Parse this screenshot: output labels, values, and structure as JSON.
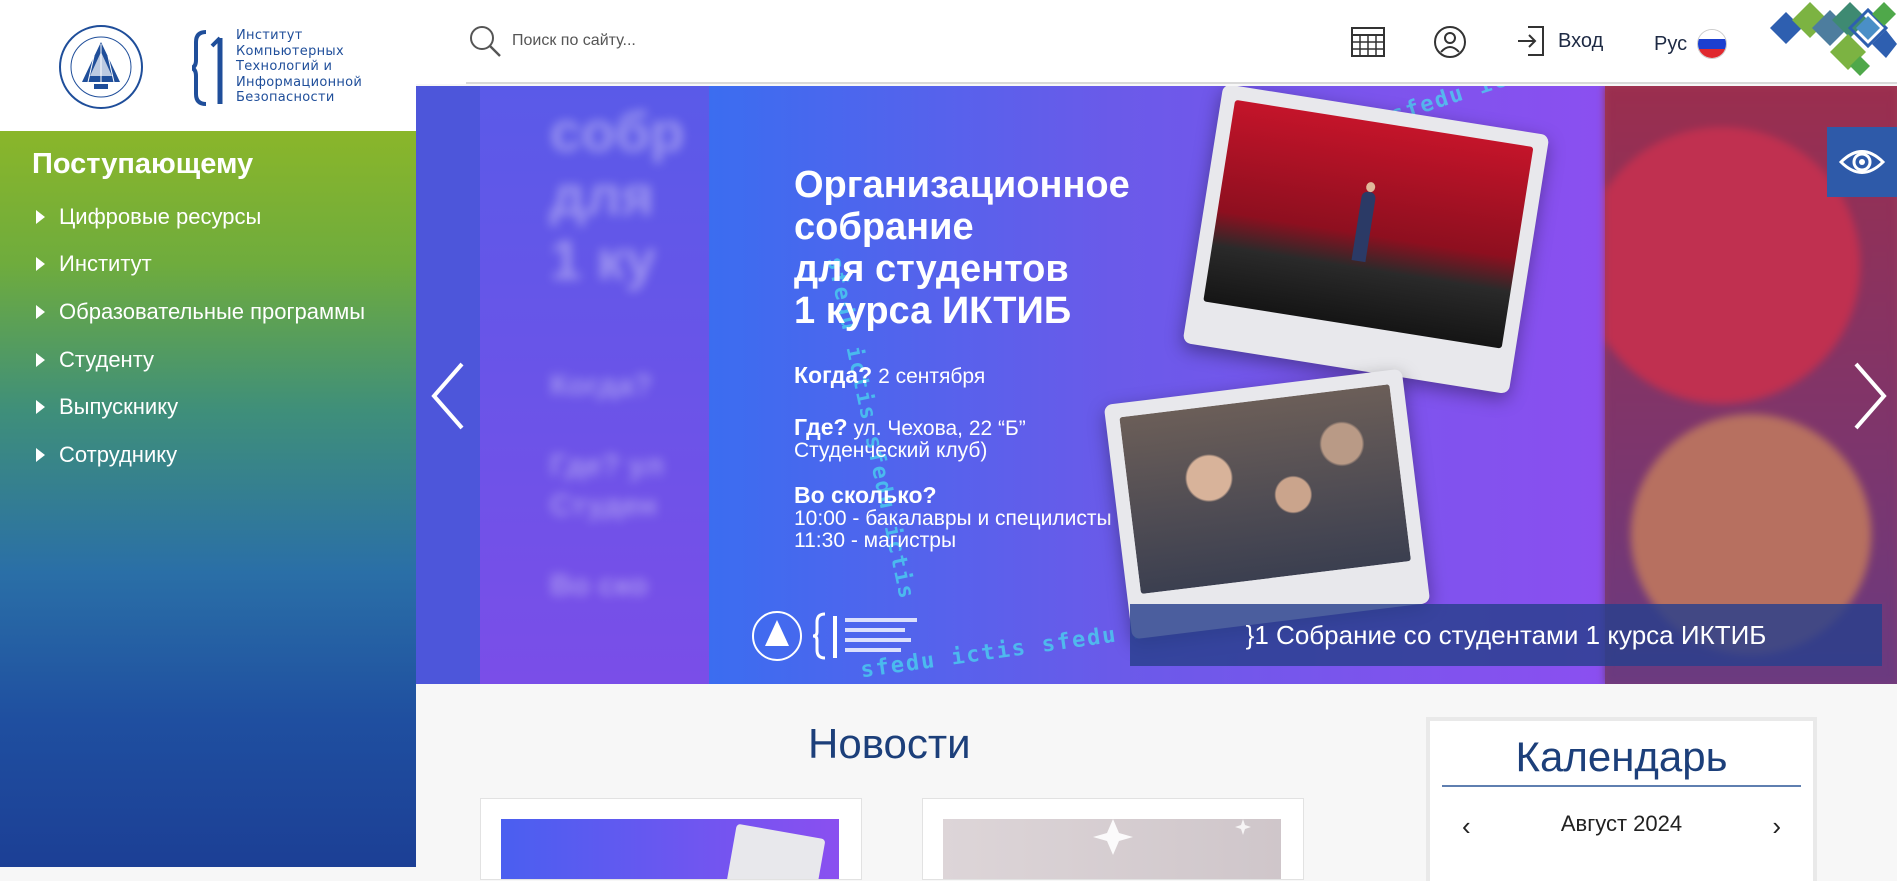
{
  "sidebar": {
    "institute_logo_text": "Институт\nКомпьютерных\nТехнологий и\nИнформационной\nБезопасности",
    "menu_title": "Поступающему",
    "items": [
      {
        "label": "Цифровые ресурсы"
      },
      {
        "label": "Институт"
      },
      {
        "label": "Образовательные программы"
      },
      {
        "label": "Студенту"
      },
      {
        "label": "Выпускнику"
      },
      {
        "label": "Сотруднику"
      }
    ]
  },
  "header": {
    "search_placeholder": "Поиск по сайту...",
    "login_label": "Вход",
    "language_label": "Рус",
    "icons": [
      "search-icon",
      "calendar-grid-icon",
      "user-icon",
      "login-icon",
      "flag-ru-icon",
      "eye-icon"
    ]
  },
  "slider": {
    "heading": "Организационное\nсобрание\nдля студентов\n1 курса ИКТИБ",
    "when_label": "Когда?",
    "when_value": "2 сентября",
    "where_label": "Где?",
    "where_value": "ул. Чехова, 22 “Б”",
    "where_value2": "Студенческий клуб)",
    "time_label": "Во сколько?",
    "time_line1": "10:00 - бакалавры и специлисты",
    "time_line2": "11:30 - магистры",
    "ring_text": "sfedu ictis sfedu ictis",
    "caption": "}1 Собрание со студентами 1 курса ИКТИБ",
    "colors": {
      "accent": "#49d7ef",
      "bg_from": "#3b6df0",
      "bg_to": "#8b4ff0"
    }
  },
  "news": {
    "title": "Новости"
  },
  "calendar": {
    "title": "Календарь",
    "month": "Август 2024",
    "prev": "‹",
    "next": "›"
  }
}
